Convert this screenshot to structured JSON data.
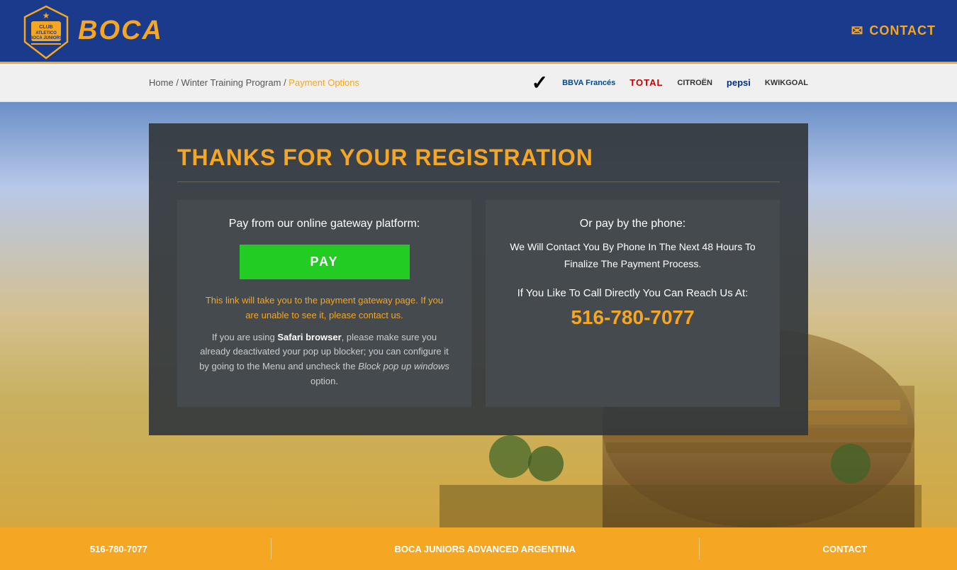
{
  "header": {
    "logo_text": "BOCA",
    "contact_label": "CONTACT",
    "contact_icon": "✉"
  },
  "breadcrumb": {
    "home": "Home",
    "separator1": " / ",
    "program": "Winter Training Program",
    "separator2": " / ",
    "active": "Payment Options"
  },
  "sponsors": [
    {
      "name": "Nike",
      "display": "✔",
      "class": "sponsor-nike"
    },
    {
      "name": "BBVA Francés",
      "display": "BBVA Francés",
      "class": "sponsor-bbva"
    },
    {
      "name": "Total",
      "display": "TOTAL",
      "class": "sponsor-total"
    },
    {
      "name": "Citroën",
      "display": "CITROËN",
      "class": "sponsor-citroen"
    },
    {
      "name": "Pepsi",
      "display": "pepsi",
      "class": "sponsor-pepsi"
    },
    {
      "name": "KwikGoal",
      "display": "KWIKGOAL",
      "class": "sponsor-kwik"
    }
  ],
  "registration": {
    "title": "THANKS FOR YOUR REGISTRATION",
    "left_panel": {
      "title": "Pay from our online gateway platform:",
      "button_label": "PAY",
      "warning_text": "This link will take you to the payment gateway page. If you are unable to see it, please contact us.",
      "info_text_before": "If you are using ",
      "info_bold": "Safari browser",
      "info_text_after": ", please make sure you already deactivated your pop up blocker; you can configure it by going to the Menu and uncheck the ",
      "info_italic": "Block pop up windows",
      "info_end": " option."
    },
    "right_panel": {
      "phone_title": "Or pay by the phone:",
      "phone_subtitle": "We Will Contact You By Phone In The Next 48 Hours To Finalize The Payment Process.",
      "call_text": "If You Like To Call Directly You Can Reach Us At:",
      "phone_number": "516-780-7077"
    }
  },
  "footer": {
    "text1": "516-780-7077",
    "text2": "BOCA JUNIORS ADVANCED ARGENTINA",
    "text3": "CONTACT"
  }
}
